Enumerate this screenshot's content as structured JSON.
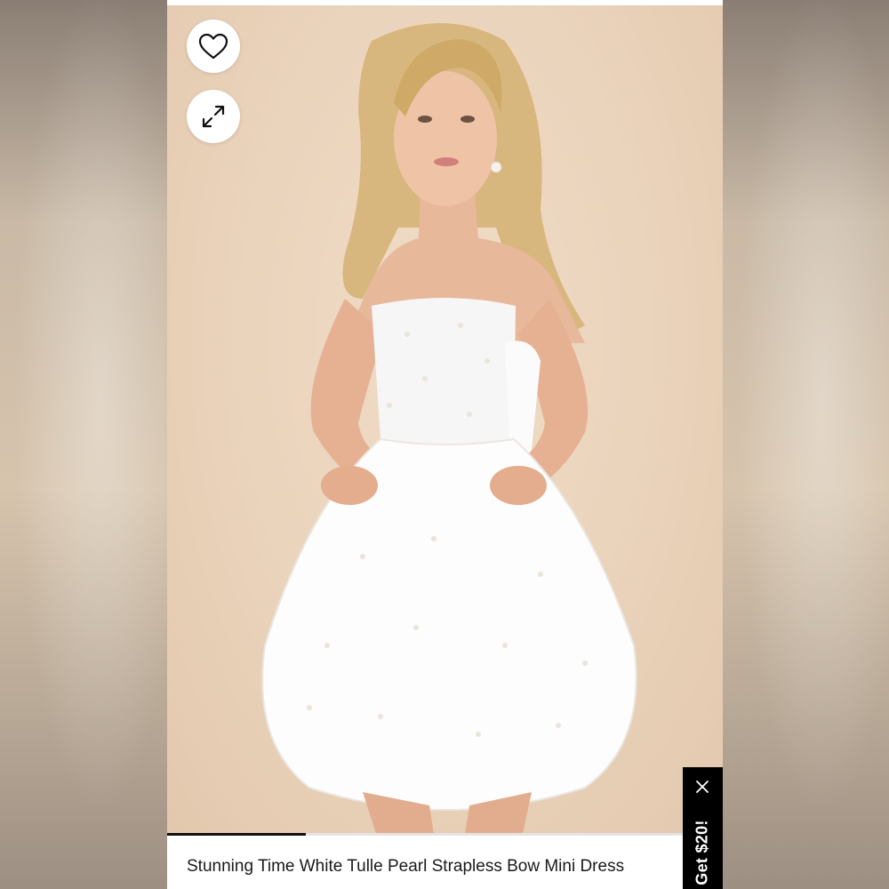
{
  "product": {
    "title": "Stunning Time White Tulle Pearl Strapless Bow Mini Dress",
    "image_progress": 0.25
  },
  "actions": {
    "favorite_icon": "heart-icon",
    "expand_icon": "expand-icon"
  },
  "promo": {
    "label": "Get $20!",
    "close_icon": "close-icon"
  },
  "colors": {
    "promo_background": "#000000",
    "progress_active": "#111111",
    "hero_background": "#ead3bb"
  }
}
